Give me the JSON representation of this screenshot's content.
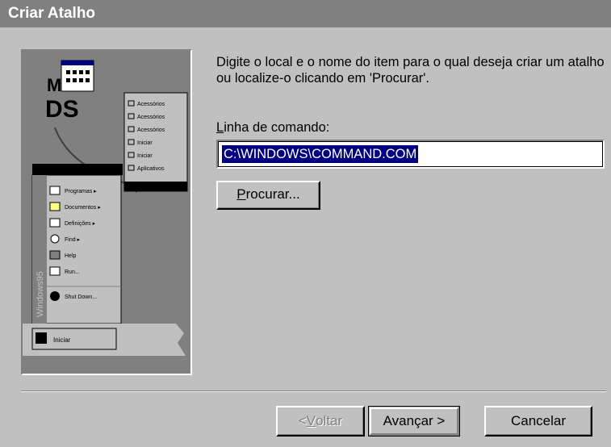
{
  "window": {
    "title": "Criar Atalho"
  },
  "illustration": {
    "sidebar_brand": "Windows95",
    "start_menu_items": [
      "Programas",
      "Documentos",
      "Definições",
      "Find",
      "Help",
      "Run...",
      "Shut Down..."
    ],
    "submenu_items": [
      "Acessórios",
      "Acessórios",
      "Acessórios",
      "Iniciar",
      "Iniciar",
      "Aplicativos"
    ],
    "start_button_label": "Iniciar"
  },
  "main": {
    "prompt": "Digite o local e o nome do item para o qual deseja criar um atalho ou localize-o clicando em 'Procurar'.",
    "field_label_mnemonic": "L",
    "field_label_rest": "inha de comando:",
    "command_line_value": "C:\\WINDOWS\\COMMAND.COM",
    "browse_mnemonic": "P",
    "browse_rest": "rocurar..."
  },
  "footer": {
    "back_prefix": "< ",
    "back_mnemonic": "V",
    "back_rest": "oltar",
    "next_label": "Avançar >",
    "cancel_label": "Cancelar"
  },
  "colors": {
    "title_bar": "#808080",
    "face": "#c0c0c0",
    "selection": "#000080"
  }
}
